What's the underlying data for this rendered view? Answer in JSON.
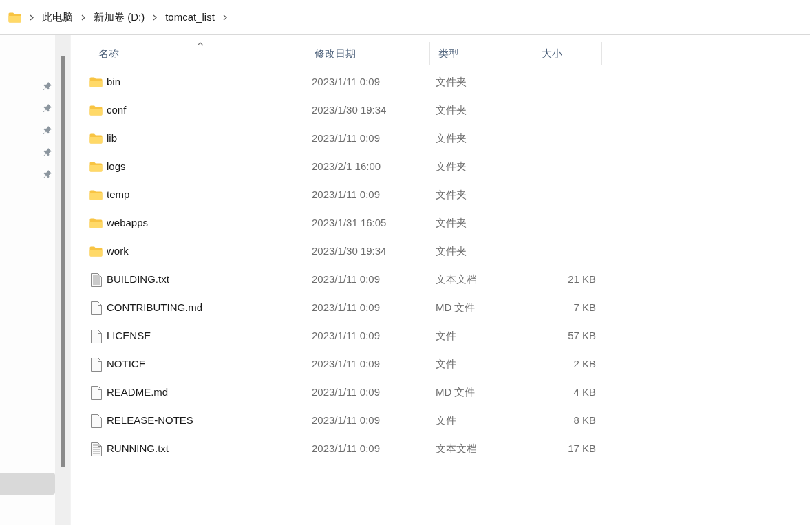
{
  "breadcrumb": [
    "此电脑",
    "新加卷 (D:)",
    "tomcat_list"
  ],
  "sidebar": {
    "items": [
      {
        "pinned": true,
        "selected": false
      },
      {
        "pinned": true,
        "selected": false
      },
      {
        "pinned": true,
        "selected": false
      },
      {
        "pinned": true,
        "selected": false
      },
      {
        "pinned": true,
        "selected": false
      },
      {
        "pinned": false,
        "selected": true
      }
    ]
  },
  "table": {
    "columns": [
      "名称",
      "修改日期",
      "类型",
      "大小"
    ],
    "rows": [
      {
        "kind": "folder",
        "name": "bin",
        "date": "2023/1/11 0:09",
        "type": "文件夹"
      },
      {
        "kind": "folder",
        "name": "conf",
        "date": "2023/1/30 19:34",
        "type": "文件夹"
      },
      {
        "kind": "folder",
        "name": "lib",
        "date": "2023/1/11 0:09",
        "type": "文件夹"
      },
      {
        "kind": "folder",
        "name": "logs",
        "date": "2023/2/1 16:00",
        "type": "文件夹"
      },
      {
        "kind": "folder",
        "name": "temp",
        "date": "2023/1/11 0:09",
        "type": "文件夹"
      },
      {
        "kind": "folder",
        "name": "webapps",
        "date": "2023/1/31 16:05",
        "type": "文件夹"
      },
      {
        "kind": "folder",
        "name": "work",
        "date": "2023/1/30 19:34",
        "type": "文件夹"
      },
      {
        "kind": "text",
        "name": "BUILDING.txt",
        "date": "2023/1/11 0:09",
        "type": "文本文档",
        "size": "21 KB"
      },
      {
        "kind": "file",
        "name": "CONTRIBUTING.md",
        "date": "2023/1/11 0:09",
        "type": "MD 文件",
        "size": "7 KB"
      },
      {
        "kind": "file",
        "name": "LICENSE",
        "date": "2023/1/11 0:09",
        "type": "文件",
        "size": "57 KB"
      },
      {
        "kind": "file",
        "name": "NOTICE",
        "date": "2023/1/11 0:09",
        "type": "文件",
        "size": "2 KB"
      },
      {
        "kind": "file",
        "name": "README.md",
        "date": "2023/1/11 0:09",
        "type": "MD 文件",
        "size": "4 KB"
      },
      {
        "kind": "file",
        "name": "RELEASE-NOTES",
        "date": "2023/1/11 0:09",
        "type": "文件",
        "size": "8 KB"
      },
      {
        "kind": "text",
        "name": "RUNNING.txt",
        "date": "2023/1/11 0:09",
        "type": "文本文档",
        "size": "17 KB"
      }
    ]
  }
}
